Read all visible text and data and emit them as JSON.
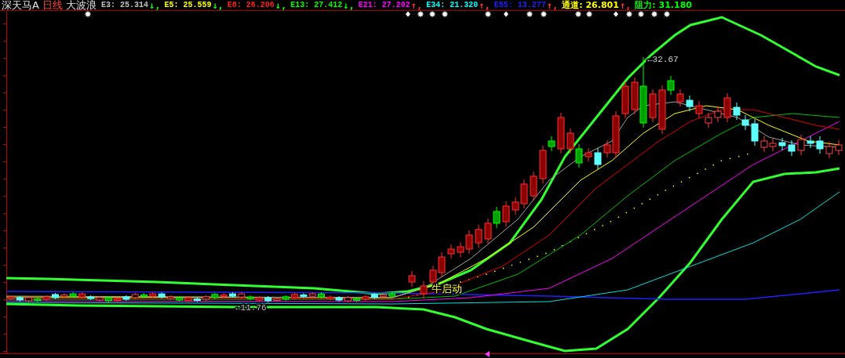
{
  "header": {
    "name": "深天马A",
    "period": "日线",
    "indicator": "大波浪"
  },
  "indicators": [
    {
      "label": "E3:",
      "value": "25.314",
      "arrow": {
        "text": "↓,",
        "color": "#00ff00"
      },
      "color": "#c0c0c0"
    },
    {
      "label": "E5:",
      "value": "25.559",
      "arrow": {
        "text": "↓,",
        "color": "#00ff00"
      },
      "color": "#ffff00"
    },
    {
      "label": "E8:",
      "value": "26.206",
      "arrow": {
        "text": "↓,",
        "color": "#00ff00"
      },
      "color": "#ff2020"
    },
    {
      "label": "E13:",
      "value": "27.412",
      "arrow": {
        "text": "↓,",
        "color": "#00ff00"
      },
      "color": "#00ff00"
    },
    {
      "label": "E21:",
      "value": "27.202",
      "arrow": {
        "text": "↑,",
        "color": "#ff3030"
      },
      "color": "#ff00ff"
    },
    {
      "label": "E34:",
      "value": "21.320",
      "arrow": {
        "text": "↑,",
        "color": "#ff3030"
      },
      "color": "#00ffff"
    },
    {
      "label": "E55:",
      "value": "13.277",
      "arrow": {
        "text": "↑,",
        "color": "#ff3030"
      },
      "color": "#2020ff"
    },
    {
      "label": "通道:",
      "value": "26.801",
      "arrow": {
        "text": "↑,",
        "color": "#ff3030"
      },
      "color": "#ffff00"
    },
    {
      "label": "阻力:",
      "value": "31.180",
      "color": "#00ff00"
    }
  ],
  "annotations": [
    {
      "kind": "high",
      "text": "←32.67"
    },
    {
      "kind": "low",
      "text": "←11.76"
    },
    {
      "kind": "signal",
      "text": "牛启动"
    }
  ]
}
